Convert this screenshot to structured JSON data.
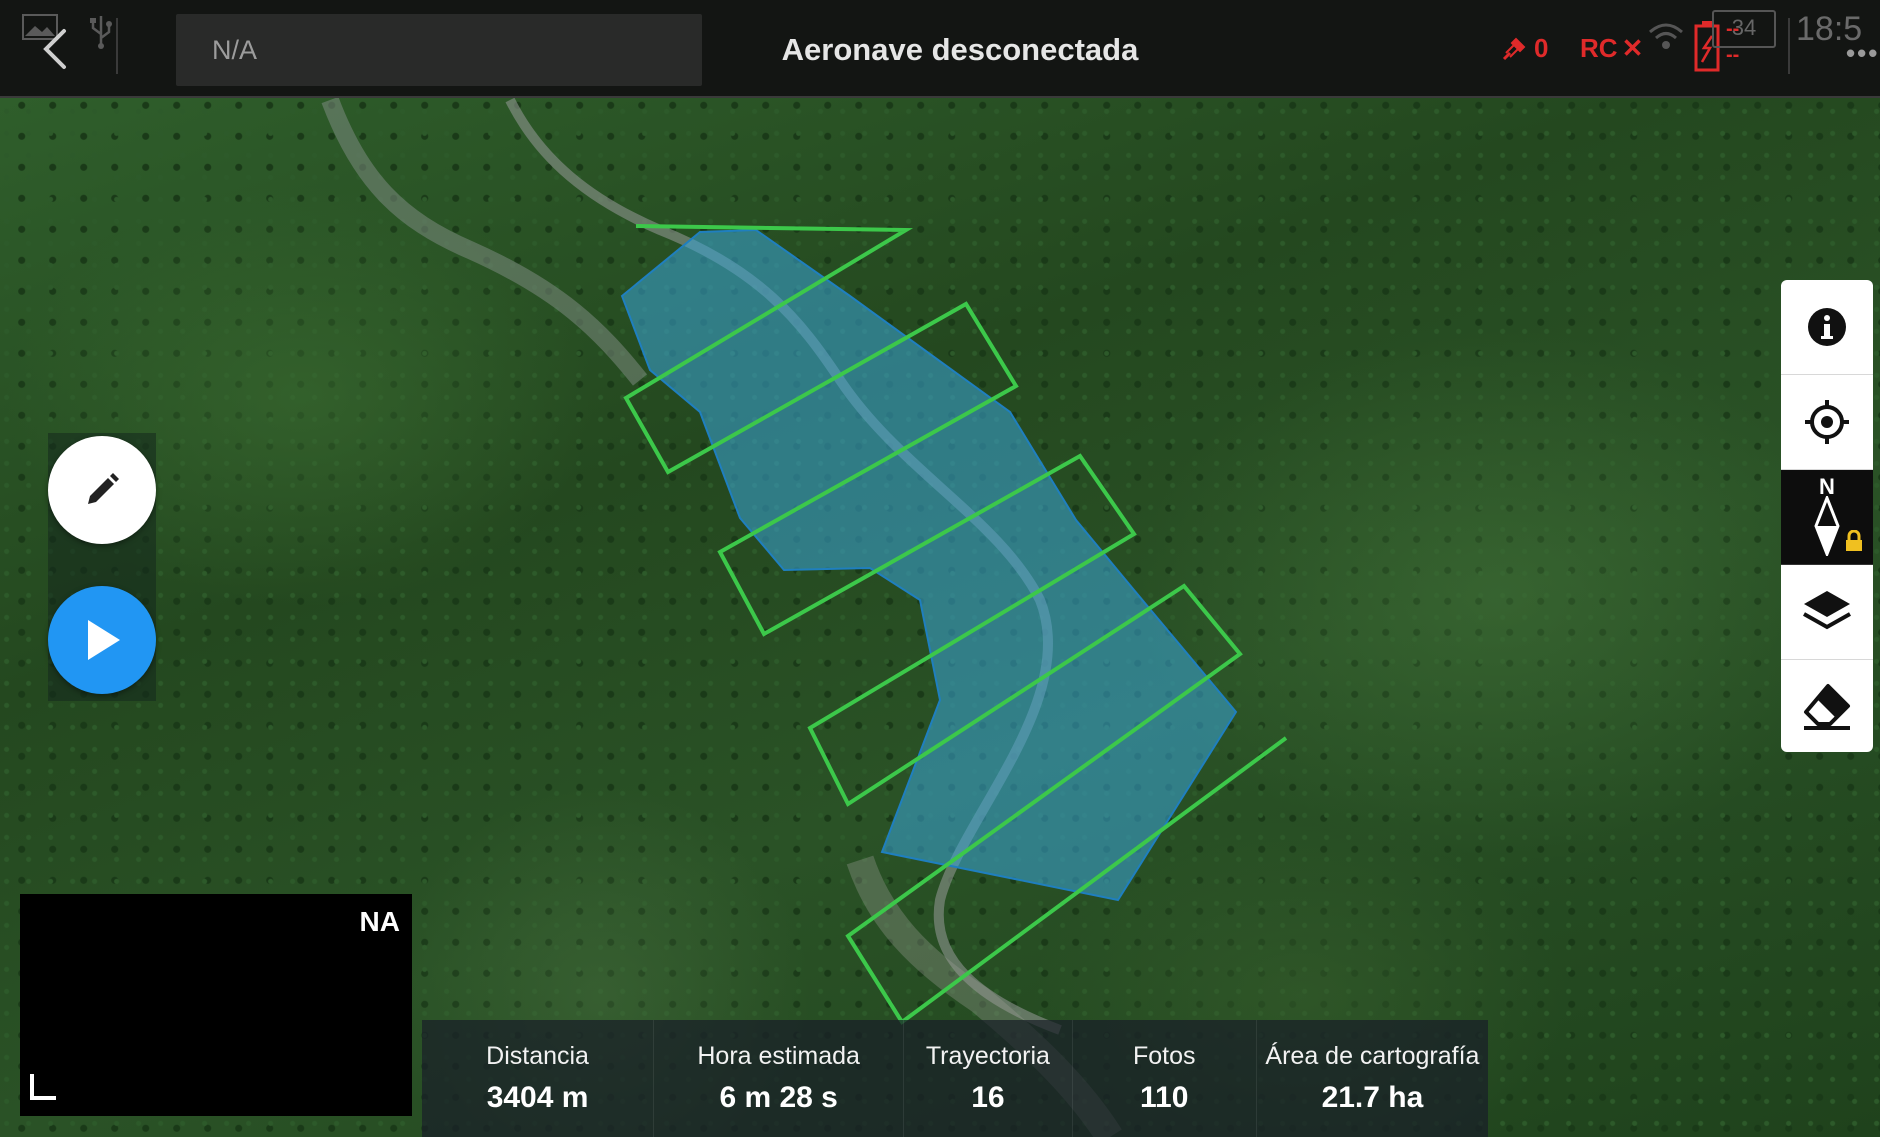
{
  "topbar": {
    "mission_name": "N/A",
    "title": "Aeronave desconectada",
    "gps_count": "0",
    "rc_label": "RC",
    "rc_status": "✕",
    "battery_percent": "34",
    "battery_voltage_top": "--",
    "battery_voltage_bottom": "--",
    "time": "18:5"
  },
  "colors": {
    "accent_blue": "#2196f3",
    "status_red": "#e02a2a",
    "flight_path": "#3cc84a",
    "survey_area": "#3aa6d8"
  },
  "icons": {
    "back": "chevron-left-icon",
    "gallery": "gallery-icon",
    "usb": "usb-icon",
    "gps": "satellite-icon",
    "wifi": "wifi-icon",
    "battery": "battery-icon",
    "info": "info-icon",
    "locate": "locate-target-icon",
    "compass": "compass-north-icon",
    "lock": "lock-icon",
    "layers": "layers-icon",
    "eraser": "eraser-icon",
    "edit": "pencil-icon",
    "play": "play-icon"
  },
  "toolbar": {
    "compass_label": "N"
  },
  "fpv": {
    "label": "NA"
  },
  "stats": [
    {
      "label": "Distancia",
      "value": "3404 m"
    },
    {
      "label": "Hora estimada",
      "value": "6 m 28 s"
    },
    {
      "label": "Trayectoria",
      "value": "16"
    },
    {
      "label": "Fotos",
      "value": "110"
    },
    {
      "label": "Área de cartografía",
      "value": "21.7 ha"
    }
  ]
}
